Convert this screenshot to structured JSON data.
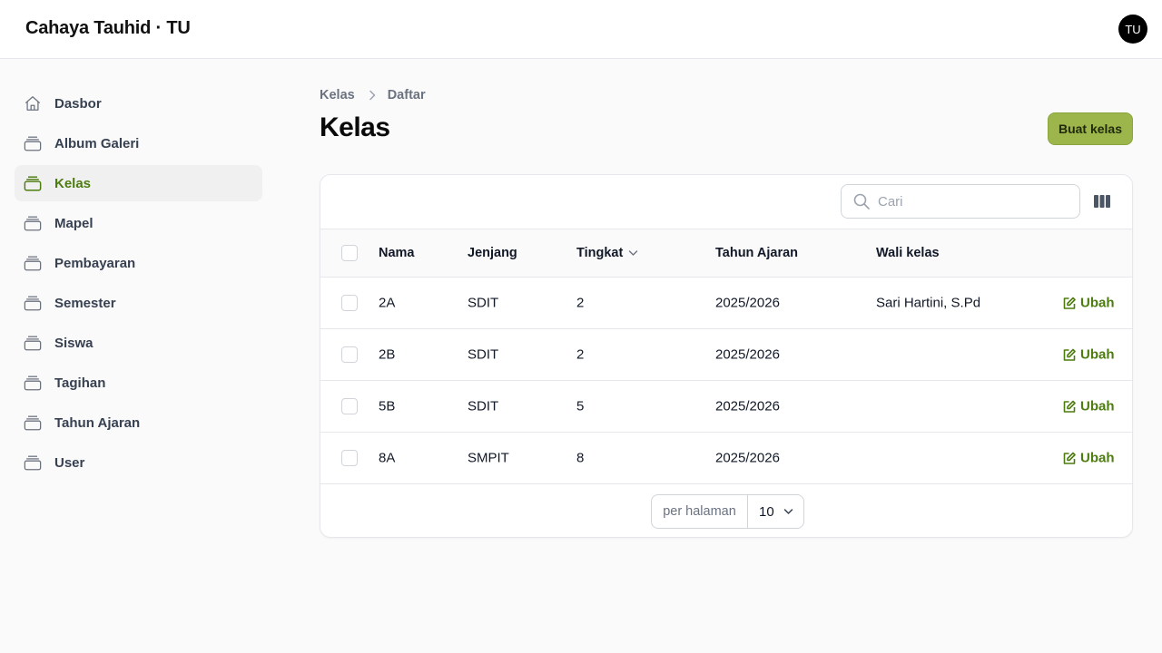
{
  "app": {
    "brand": "Cahaya Tauhid · TU",
    "avatar_initials": "TU"
  },
  "colors": {
    "accent": "#9cb64b",
    "accent_text": "#4d7c0f"
  },
  "sidebar": {
    "items": [
      {
        "label": "Dasbor",
        "icon": "home-icon",
        "active": false
      },
      {
        "label": "Album Galeri",
        "icon": "stack-icon",
        "active": false
      },
      {
        "label": "Kelas",
        "icon": "stack-icon",
        "active": true
      },
      {
        "label": "Mapel",
        "icon": "stack-icon",
        "active": false
      },
      {
        "label": "Pembayaran",
        "icon": "stack-icon",
        "active": false
      },
      {
        "label": "Semester",
        "icon": "stack-icon",
        "active": false
      },
      {
        "label": "Siswa",
        "icon": "stack-icon",
        "active": false
      },
      {
        "label": "Tagihan",
        "icon": "stack-icon",
        "active": false
      },
      {
        "label": "Tahun Ajaran",
        "icon": "stack-icon",
        "active": false
      },
      {
        "label": "User",
        "icon": "stack-icon",
        "active": false
      }
    ]
  },
  "breadcrumb": [
    "Kelas",
    "Daftar"
  ],
  "page": {
    "title": "Kelas",
    "create_button": "Buat kelas"
  },
  "search": {
    "placeholder": "Cari"
  },
  "table": {
    "columns": [
      "Nama",
      "Jenjang",
      "Tingkat",
      "Tahun Ajaran",
      "Wali kelas"
    ],
    "rows": [
      {
        "nama": "2A",
        "jenjang": "SDIT",
        "tingkat": "2",
        "tahun_ajaran": "2025/2026",
        "wali_kelas": "Sari Hartini, S.Pd",
        "action": "Ubah"
      },
      {
        "nama": "2B",
        "jenjang": "SDIT",
        "tingkat": "2",
        "tahun_ajaran": "2025/2026",
        "wali_kelas": "",
        "action": "Ubah"
      },
      {
        "nama": "5B",
        "jenjang": "SDIT",
        "tingkat": "5",
        "tahun_ajaran": "2025/2026",
        "wali_kelas": "",
        "action": "Ubah"
      },
      {
        "nama": "8A",
        "jenjang": "SMPIT",
        "tingkat": "8",
        "tahun_ajaran": "2025/2026",
        "wali_kelas": "",
        "action": "Ubah"
      }
    ]
  },
  "pagination": {
    "label": "per halaman",
    "value": "10"
  }
}
